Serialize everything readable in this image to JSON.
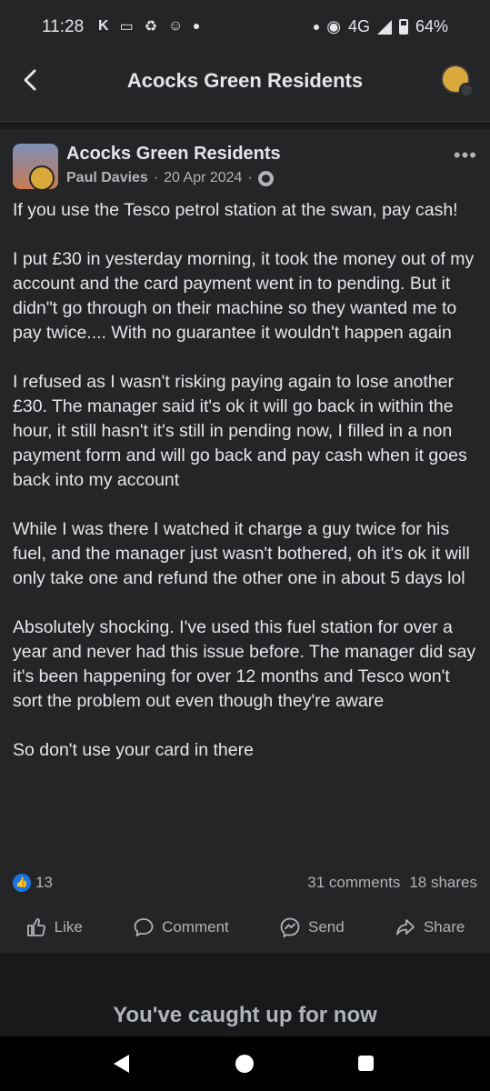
{
  "status_bar": {
    "time": "11:28",
    "network": "4G",
    "battery": "64%",
    "left_icons": [
      "k-icon",
      "wallet-icon",
      "recycle-icon",
      "smiley-icon"
    ],
    "battery_level": 0.64
  },
  "header": {
    "title": "Acocks Green Residents"
  },
  "post": {
    "group_name": "Acocks Green Residents",
    "author": "Paul Davies",
    "date": "20 Apr 2024",
    "separator": "·",
    "paragraphs": [
      "If you use the Tesco petrol station at the swan, pay cash!",
      "I put £30 in yesterday morning, it took the money out of my account and the card payment went in to pending. But it didn\"t go through on their machine so they wanted me to pay twice.... With no guarantee it wouldn't happen again",
      "I refused as I wasn't risking paying again to lose another £30. The manager said it's ok it will go back in within the hour, it still hasn't it's still in pending now, I filled in a non payment form and will go back and pay cash when it goes back into my account",
      "While I was there I watched it charge a guy twice for his fuel, and the manager just wasn't bothered, oh it's ok it will only take one and refund the other one in about 5 days lol",
      "Absolutely shocking. I've used this fuel station for over a year and never had this issue before. The manager did say it's been happening for over 12 months and Tesco won't sort the problem out even though they're aware",
      "So don't use your card in there"
    ],
    "likes": "13",
    "comments": "31 comments",
    "shares": "18 shares",
    "actions": {
      "like": "Like",
      "comment": "Comment",
      "send": "Send",
      "share": "Share"
    }
  },
  "feed": {
    "caught_up": "You've caught up for now"
  },
  "colors": {
    "background": "#18191a",
    "card": "#242526",
    "text": "#e4e6eb",
    "secondary": "#b0b3b8",
    "accent": "#1b74e4"
  }
}
